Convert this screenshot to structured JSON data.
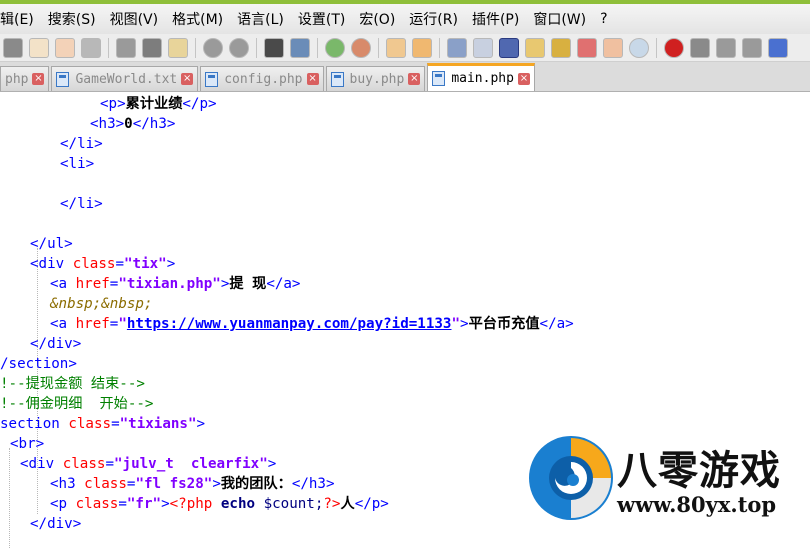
{
  "menubar": {
    "items": [
      "辑(E)",
      "搜索(S)",
      "视图(V)",
      "格式(M)",
      "语言(L)",
      "设置(T)",
      "宏(O)",
      "运行(R)",
      "插件(P)",
      "窗口(W)",
      "?"
    ]
  },
  "tabs": [
    {
      "label": "php",
      "active": false
    },
    {
      "label": "GameWorld.txt",
      "active": false
    },
    {
      "label": "config.php",
      "active": false
    },
    {
      "label": "buy.php",
      "active": false
    },
    {
      "label": "main.php",
      "active": true
    }
  ],
  "code": {
    "l1": {
      "open_t": "<p>",
      "text": "累计业绩",
      "close_t": "</p>"
    },
    "l2": {
      "open_t": "<h3>",
      "text": "0",
      "close_t": "</h3>"
    },
    "l3": {
      "t": "</li>"
    },
    "l4": {
      "t": "<li>"
    },
    "l5": {
      "t": "</li>"
    },
    "l6": {
      "t": "</ul>"
    },
    "l7": {
      "t1": "<div ",
      "a": "class",
      "eq": "=",
      "v": "\"tix\"",
      "t2": ">"
    },
    "l8": {
      "t1": "<a ",
      "a": "href",
      "eq": "=",
      "v": "\"tixian.php\"",
      "t2": ">",
      "text": "提 现",
      "t3": "</a>"
    },
    "l9": {
      "ent": "&nbsp;&nbsp;"
    },
    "l10": {
      "t1": "<a ",
      "a": "href",
      "eq": "=",
      "q1": "\"",
      "link": "https://www.yuanmanpay.com/pay?id=1133",
      "q2": "\"",
      "t2": ">",
      "text": "平台币充值",
      "t3": "</a>"
    },
    "l11": {
      "t": "</div>"
    },
    "l12": {
      "t": "/section>"
    },
    "l13": {
      "c": "!--提现金额 结束-->"
    },
    "l14": {
      "c": "!--佣金明细  开始-->"
    },
    "l15": {
      "t1": "section ",
      "a": "class",
      "eq": "=",
      "v": "\"tixians\"",
      "t2": ">"
    },
    "l16": {
      "t": "<br>"
    },
    "l17": {
      "t1": "<div ",
      "a": "class",
      "eq": "=",
      "v": "\"julv_t  clearfix\"",
      "t2": ">"
    },
    "l18": {
      "t1": "<h3 ",
      "a": "class",
      "eq": "=",
      "v": "\"fl fs28\"",
      "t2": ">",
      "text": "我的团队：",
      "t3": "</h3>"
    },
    "l19": {
      "t1": "<p ",
      "a": "class",
      "eq": "=",
      "v": "\"fr\"",
      "t2": ">",
      "p1": "<?php",
      "sp": " ",
      "kw": "echo",
      "var": " $count;",
      "p2": "?>",
      "text": "人",
      "t3": "</p>"
    },
    "l20": {
      "t": "</div>"
    }
  },
  "watermark": {
    "title": "八零游戏",
    "url": "www.80yx.top"
  },
  "colors": {
    "tag": "#0000ff",
    "attribute": "#ff0000",
    "string": "#8000ff",
    "comment": "#008000",
    "entity": "#8b6c00",
    "active_tab_accent": "#f5a623"
  }
}
